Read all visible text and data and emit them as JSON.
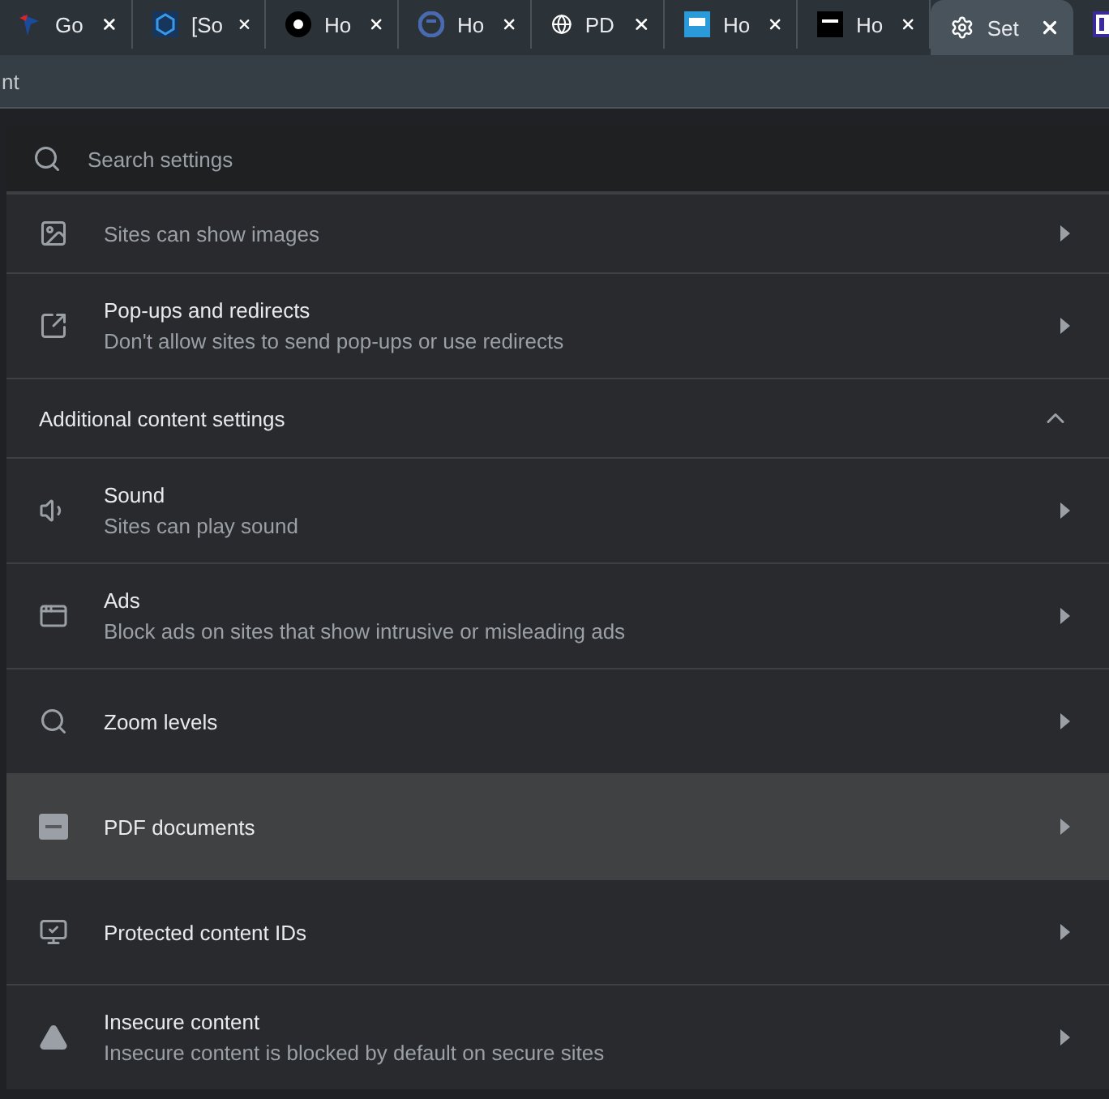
{
  "tabs": [
    {
      "label": "Go",
      "selected": false
    },
    {
      "label": "[So",
      "selected": false
    },
    {
      "label": "Ho",
      "selected": false
    },
    {
      "label": "Ho",
      "selected": false
    },
    {
      "label": "PD",
      "selected": false
    },
    {
      "label": "Ho",
      "selected": false
    },
    {
      "label": "Ho",
      "selected": false
    },
    {
      "label": "Set",
      "selected": true
    },
    {
      "selected": false
    }
  ],
  "address_bar": {
    "value": "nt"
  },
  "search": {
    "placeholder": "Search settings"
  },
  "rows": [
    {
      "kind": "item",
      "subtitle": "Sites can show images",
      "highlighted": false
    },
    {
      "kind": "item",
      "title": "Pop-ups and redirects",
      "subtitle": "Don't allow sites to send pop-ups or use redirects",
      "highlighted": false
    },
    {
      "kind": "section",
      "title": "Additional content settings",
      "expanded": true
    },
    {
      "kind": "item",
      "title": "Sound",
      "subtitle": "Sites can play sound",
      "highlighted": false
    },
    {
      "kind": "item",
      "title": "Ads",
      "subtitle": "Block ads on sites that show intrusive or misleading ads",
      "highlighted": false
    },
    {
      "kind": "item",
      "title": "Zoom levels",
      "highlighted": false
    },
    {
      "kind": "item",
      "title": "PDF documents",
      "highlighted": true
    },
    {
      "kind": "item",
      "title": "Protected content IDs",
      "highlighted": false
    },
    {
      "kind": "item",
      "title": "Insecure content",
      "subtitle": "Insecure content is blocked by default on secure sites",
      "highlighted": false
    }
  ]
}
